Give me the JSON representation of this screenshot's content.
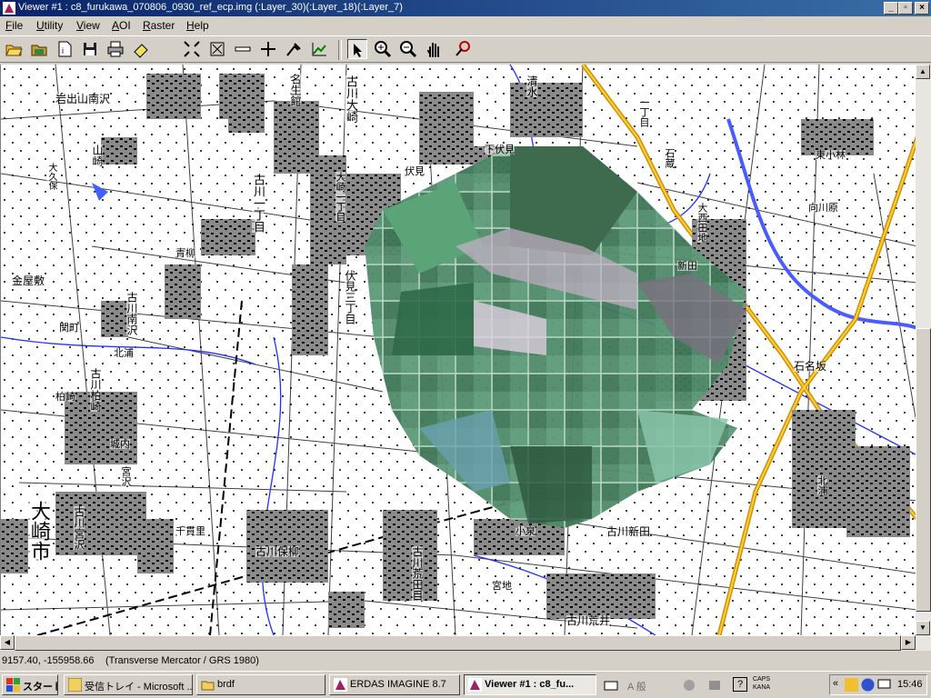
{
  "window": {
    "title": "Viewer #1 : c8_furukawa_070806_0930_ref_ecp.img (:Layer_30)(:Layer_18)(:Layer_7)",
    "minimize": "_",
    "maximize": "▫",
    "close": "×"
  },
  "menu": {
    "items": [
      {
        "label": "File",
        "accel": "F",
        "rest": "ile"
      },
      {
        "label": "Utility",
        "accel": "U",
        "rest": "tility"
      },
      {
        "label": "View",
        "accel": "V",
        "rest": "iew"
      },
      {
        "label": "AOI",
        "accel": "A",
        "rest": "OI"
      },
      {
        "label": "Raster",
        "accel": "R",
        "rest": "aster"
      },
      {
        "label": "Help",
        "accel": "H",
        "rest": "elp"
      }
    ]
  },
  "toolbar": {
    "tools": [
      "open-icon",
      "open-layer-icon",
      "new-icon",
      "save-icon",
      "print-icon",
      "eraser-icon",
      "fit-icon",
      "scale-icon",
      "measure-icon",
      "crosshair-icon",
      "pick-icon",
      "profile-icon",
      "select-icon",
      "zoom-in-icon",
      "zoom-out-icon",
      "pan-icon",
      "inquire-icon"
    ]
  },
  "map": {
    "labels": [
      {
        "text": "岩出山南沢"
      },
      {
        "text": "山崎"
      },
      {
        "text": "大久保"
      },
      {
        "text": "名生館"
      },
      {
        "text": "古川大崎"
      },
      {
        "text": "清水"
      },
      {
        "text": "下伏見"
      },
      {
        "text": "大崎一丁目"
      },
      {
        "text": "古川一丁目"
      },
      {
        "text": "青柳"
      },
      {
        "text": "伏見"
      },
      {
        "text": "伏見三丁目"
      },
      {
        "text": "金屋敷"
      },
      {
        "text": "古川南沢"
      },
      {
        "text": "関町"
      },
      {
        "text": "北浦"
      },
      {
        "text": "古川柏崎"
      },
      {
        "text": "柏崎"
      },
      {
        "text": "城内"
      },
      {
        "text": "宮沢"
      },
      {
        "text": "大崎市"
      },
      {
        "text": "古川宮沢"
      },
      {
        "text": "千貫里"
      },
      {
        "text": "古川保柳"
      },
      {
        "text": "古川荒田目"
      },
      {
        "text": "古川新田"
      },
      {
        "text": "小泉"
      },
      {
        "text": "宮地"
      },
      {
        "text": "古川荒井"
      },
      {
        "text": "東小林"
      },
      {
        "text": "向川原"
      },
      {
        "text": "大西田地"
      },
      {
        "text": "新田"
      },
      {
        "text": "石名坂"
      },
      {
        "text": "北浦"
      },
      {
        "text": "一丁目"
      },
      {
        "text": "石蔵"
      }
    ]
  },
  "status": {
    "coords": "9157.40, -155958.66",
    "projection": "(Transverse Mercator / GRS 1980)"
  },
  "taskbar": {
    "start": "スタート",
    "tasks": [
      {
        "label": "受信トレイ - Microsoft ..."
      },
      {
        "label": "brdf"
      },
      {
        "label": "ERDAS IMAGINE 8.7"
      },
      {
        "label": "Viewer #1 : c8_fu..."
      }
    ],
    "ime": "A 般",
    "caps": "CAPS",
    "kana": "KANA",
    "clock": "15:46"
  }
}
